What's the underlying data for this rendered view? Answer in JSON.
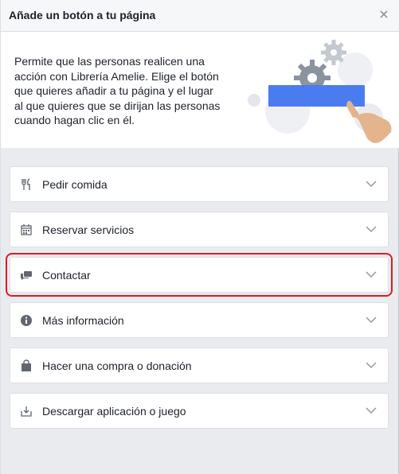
{
  "dialog": {
    "title": "Añade un botón a tu página",
    "close_icon": "close-icon",
    "intro": "Permite que las personas realicen una acción con Librería Amelie. Elige el botón que quieres añadir a tu página y el lugar al que quieres que se dirijan las personas cuando hagan clic en él."
  },
  "options": [
    {
      "label": "Pedir comida",
      "icon": "fork-knife-icon"
    },
    {
      "label": "Reservar servicios",
      "icon": "calendar-icon"
    },
    {
      "label": "Contactar",
      "icon": "chat-icon"
    },
    {
      "label": "Más información",
      "icon": "info-icon"
    },
    {
      "label": "Hacer una compra o donación",
      "icon": "shopping-bag-icon"
    },
    {
      "label": "Descargar aplicación o juego",
      "icon": "download-icon"
    }
  ],
  "colors": {
    "accent": "#4a7cf0",
    "highlight": "#e01b24",
    "background": "#e9ebee"
  }
}
